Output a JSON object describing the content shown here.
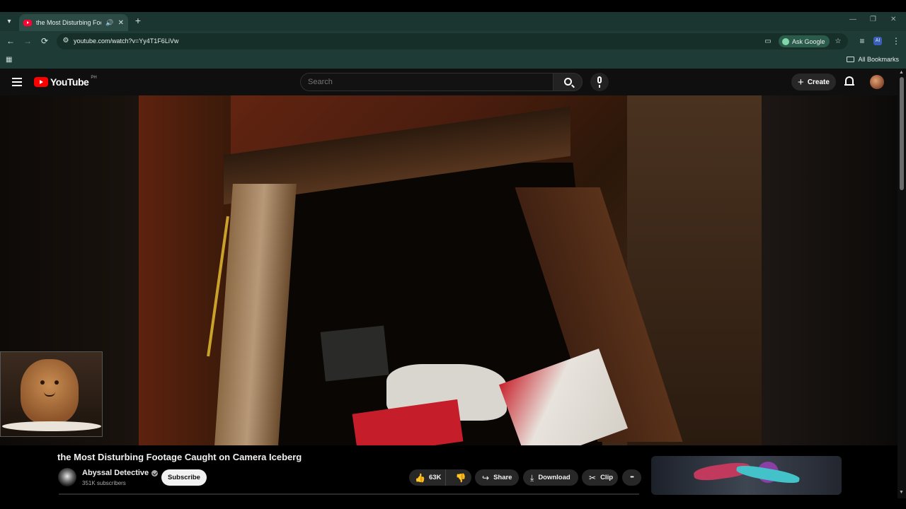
{
  "browser": {
    "tab_title": "the Most Disturbing Footage Caught on Camera Iceberg",
    "url": "youtube.com/watch?v=Yy4T1F6LiVw",
    "ask_google_label": "Ask Google",
    "all_bookmarks_label": "All Bookmarks",
    "accent_color": "#1f3b35"
  },
  "youtube": {
    "logo_text": "YouTube",
    "country_code": "PH",
    "search_placeholder": "Search",
    "create_label": "Create"
  },
  "video": {
    "title": "the Most Disturbing Footage Caught on Camera Iceberg",
    "channel_name": "Abyssal Detective",
    "subscribers": "351K subscribers",
    "subscribe_label": "Subscribe",
    "likes": "63K",
    "share_label": "Share",
    "download_label": "Download",
    "clip_label": "Clip"
  },
  "icons": {
    "tab_list": "▾",
    "audio": "🔊",
    "close": "✕",
    "new_tab": "+",
    "back": "←",
    "forward": "→",
    "reload": "⟳",
    "site_info": "⚙",
    "cast": "▭",
    "star": "☆",
    "more": "⋮",
    "apps": "▦",
    "thumbs_up": "👍",
    "thumbs_down": "👎",
    "share": "↪",
    "download": "⤓",
    "clip": "✂",
    "ellipsis": "•••"
  }
}
